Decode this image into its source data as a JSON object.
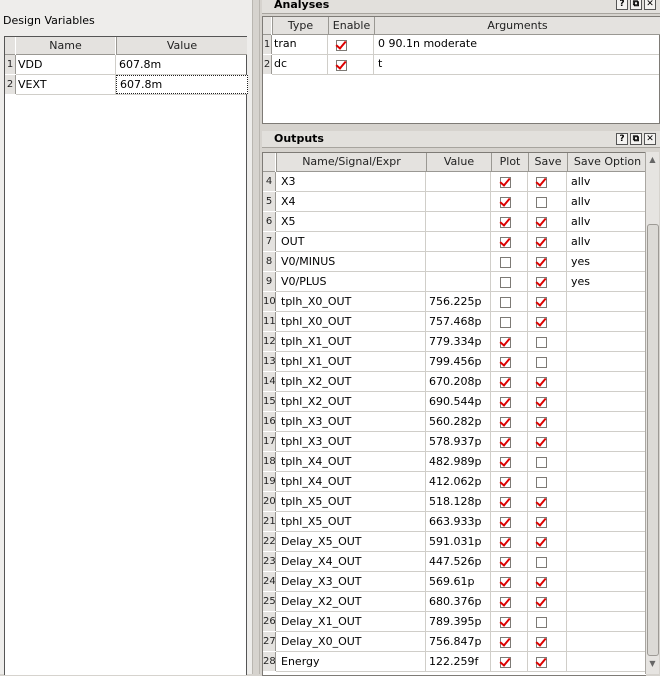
{
  "design_variables": {
    "title": "Design Variables",
    "columns": [
      "Name",
      "Value"
    ],
    "rows": [
      {
        "num": "1",
        "name": "VDD",
        "value": "607.8m"
      },
      {
        "num": "2",
        "name": "VEXT",
        "value": "607.8m"
      }
    ]
  },
  "analyses": {
    "title": "Analyses",
    "columns": [
      "Type",
      "Enable",
      "Arguments"
    ],
    "rows": [
      {
        "num": "1",
        "type": "tran",
        "enable": true,
        "args": "0 90.1n moderate"
      },
      {
        "num": "2",
        "type": "dc",
        "enable": true,
        "args": "t"
      }
    ]
  },
  "outputs": {
    "title": "Outputs",
    "columns": [
      "Name/Signal/Expr",
      "Value",
      "Plot",
      "Save",
      "Save Option"
    ],
    "rows": [
      {
        "num": "4",
        "name": "X3",
        "value": "",
        "plot": true,
        "save": true,
        "option": "allv"
      },
      {
        "num": "5",
        "name": "X4",
        "value": "",
        "plot": true,
        "save": false,
        "option": "allv"
      },
      {
        "num": "6",
        "name": "X5",
        "value": "",
        "plot": true,
        "save": true,
        "option": "allv"
      },
      {
        "num": "7",
        "name": "OUT",
        "value": "",
        "plot": true,
        "save": true,
        "option": "allv"
      },
      {
        "num": "8",
        "name": "V0/MINUS",
        "value": "",
        "plot": false,
        "save": true,
        "option": "yes"
      },
      {
        "num": "9",
        "name": "V0/PLUS",
        "value": "",
        "plot": false,
        "save": true,
        "option": "yes"
      },
      {
        "num": "10",
        "name": "tplh_X0_OUT",
        "value": "756.225p",
        "plot": false,
        "save": true,
        "option": ""
      },
      {
        "num": "11",
        "name": "tphl_X0_OUT",
        "value": "757.468p",
        "plot": false,
        "save": true,
        "option": ""
      },
      {
        "num": "12",
        "name": "tplh_X1_OUT",
        "value": "779.334p",
        "plot": true,
        "save": false,
        "option": ""
      },
      {
        "num": "13",
        "name": "tphl_X1_OUT",
        "value": "799.456p",
        "plot": true,
        "save": false,
        "option": ""
      },
      {
        "num": "14",
        "name": "tplh_X2_OUT",
        "value": "670.208p",
        "plot": true,
        "save": true,
        "option": ""
      },
      {
        "num": "15",
        "name": "tphl_X2_OUT",
        "value": "690.544p",
        "plot": true,
        "save": true,
        "option": ""
      },
      {
        "num": "16",
        "name": "tplh_X3_OUT",
        "value": "560.282p",
        "plot": true,
        "save": true,
        "option": ""
      },
      {
        "num": "17",
        "name": "tphl_X3_OUT",
        "value": "578.937p",
        "plot": true,
        "save": true,
        "option": ""
      },
      {
        "num": "18",
        "name": "tplh_X4_OUT",
        "value": "482.989p",
        "plot": true,
        "save": false,
        "option": ""
      },
      {
        "num": "19",
        "name": "tphl_X4_OUT",
        "value": "412.062p",
        "plot": true,
        "save": false,
        "option": ""
      },
      {
        "num": "20",
        "name": "tplh_X5_OUT",
        "value": "518.128p",
        "plot": true,
        "save": true,
        "option": ""
      },
      {
        "num": "21",
        "name": "tphl_X5_OUT",
        "value": "663.933p",
        "plot": true,
        "save": true,
        "option": ""
      },
      {
        "num": "22",
        "name": "Delay_X5_OUT",
        "value": "591.031p",
        "plot": true,
        "save": true,
        "option": ""
      },
      {
        "num": "23",
        "name": "Delay_X4_OUT",
        "value": "447.526p",
        "plot": true,
        "save": false,
        "option": ""
      },
      {
        "num": "24",
        "name": "Delay_X3_OUT",
        "value": "569.61p",
        "plot": true,
        "save": true,
        "option": ""
      },
      {
        "num": "25",
        "name": "Delay_X2_OUT",
        "value": "680.376p",
        "plot": true,
        "save": true,
        "option": ""
      },
      {
        "num": "26",
        "name": "Delay_X1_OUT",
        "value": "789.395p",
        "plot": true,
        "save": false,
        "option": ""
      },
      {
        "num": "27",
        "name": "Delay_X0_OUT",
        "value": "756.847p",
        "plot": true,
        "save": true,
        "option": ""
      },
      {
        "num": "28",
        "name": "Energy",
        "value": "122.259f",
        "plot": true,
        "save": true,
        "option": ""
      }
    ]
  },
  "dock_buttons": [
    "?",
    "⧉",
    "✕"
  ],
  "icons": {
    "help": "help-icon",
    "float": "float-icon",
    "close": "close-icon"
  }
}
